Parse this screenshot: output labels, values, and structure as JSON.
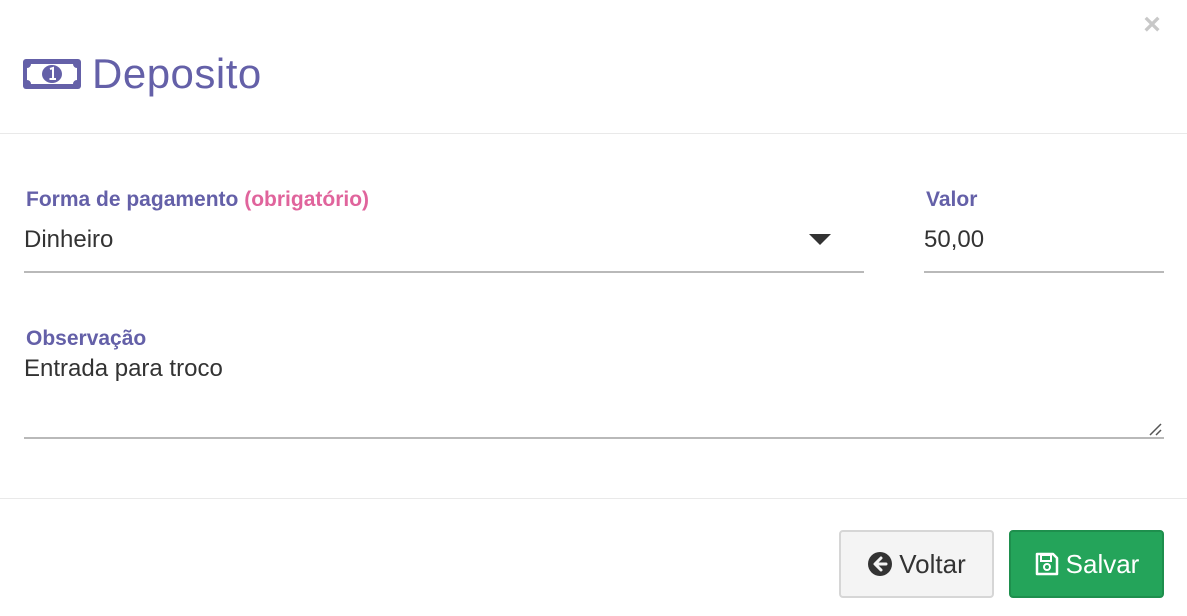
{
  "modal": {
    "title": "Deposito",
    "icon": "money-bill-icon",
    "close_label": "×"
  },
  "form": {
    "payment_method": {
      "label": "Forma de pagamento",
      "required_text": "(obrigatório)",
      "value": "Dinheiro"
    },
    "amount": {
      "label": "Valor",
      "value": "50,00"
    },
    "notes": {
      "label": "Observação",
      "value": "Entrada para troco"
    }
  },
  "buttons": {
    "back_label": "Voltar",
    "back_icon": "arrow-circle-left-icon",
    "save_label": "Salvar",
    "save_icon": "floppy-disk-icon"
  },
  "colors": {
    "accent": "#6460a8",
    "required": "#e0649c",
    "save": "#24a45a"
  }
}
